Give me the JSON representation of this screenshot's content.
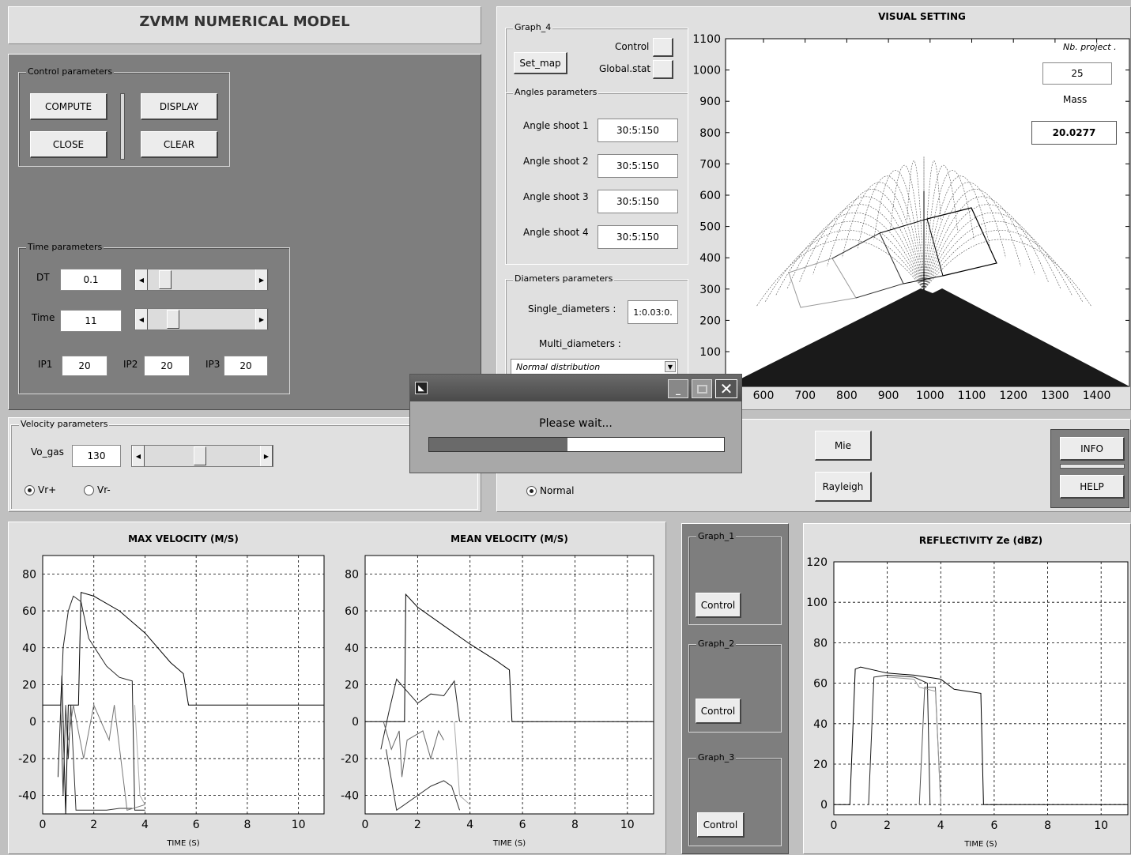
{
  "app": {
    "title": "ZVMM NUMERICAL MODEL"
  },
  "control": {
    "group": "Control parameters",
    "compute": "COMPUTE",
    "display": "DISPLAY",
    "close": "CLOSE",
    "clear": "CLEAR"
  },
  "time": {
    "group": "Time parameters",
    "dt_label": "DT",
    "dt_value": "0.1",
    "time_label": "Time",
    "time_value": "11",
    "ip1_label": "IP1",
    "ip1_value": "20",
    "ip2_label": "IP2",
    "ip2_value": "20",
    "ip3_label": "IP3",
    "ip3_value": "20",
    "dt_slider_fraction": 0.12,
    "time_slider_fraction": 0.2
  },
  "velocity": {
    "group": "Velocity parameters",
    "vo_label": "Vo_gas",
    "vo_value": "130",
    "vo_slider_fraction": 0.48,
    "vr_plus": "Vr+",
    "vr_minus": "Vr-",
    "vr_selected": "Vr+"
  },
  "graph4": {
    "group": "Graph_4",
    "set_map": "Set_map",
    "control_label": "Control",
    "global_label": "Global.stat"
  },
  "angles": {
    "group": "Angles parameters",
    "items": [
      {
        "label": "Angle shoot 1",
        "value": "30:5:150"
      },
      {
        "label": "Angle shoot 2",
        "value": "30:5:150"
      },
      {
        "label": "Angle shoot 3",
        "value": "30:5:150"
      },
      {
        "label": "Angle shoot 4",
        "value": "30:5:150"
      }
    ]
  },
  "diameters": {
    "group": "Diameters parameters",
    "single_label": "Single_diameters :",
    "single_value": "1:0.03:0.",
    "multi_label": "Multi_diameters :",
    "multi_value": "Normal distribution"
  },
  "visual": {
    "title": "VISUAL SETTING",
    "nb_project_label": "Nb. project .",
    "nb_project_value": "25",
    "mass_label": "Mass",
    "mass_value": "20.0277",
    "y_ticks": [
      "1100",
      "1000",
      "900",
      "800",
      "700",
      "600",
      "500",
      "400",
      "300",
      "200",
      "100"
    ],
    "x_ticks": [
      "600",
      "700",
      "800",
      "900",
      "1000",
      "1100",
      "1200",
      "1300",
      "1400"
    ]
  },
  "scatter": {
    "normal_label": "Normal",
    "mie": "Mie",
    "rayleigh": "Rayleigh",
    "info": "INFO",
    "help": "HELP"
  },
  "dialog": {
    "message": "Please wait...",
    "progress": 0.47,
    "minimize_icon": "minimize-icon",
    "maximize_icon": "maximize-icon",
    "close_icon": "close-icon"
  },
  "graphs": {
    "g1": "Graph_1",
    "g2": "Graph_2",
    "g3": "Graph_3",
    "control": "Control"
  },
  "chart_data": [
    {
      "type": "line",
      "title": "MAX VELOCITY (M/S)",
      "xlabel": "TIME (S)",
      "ylabel": "",
      "xlim": [
        0,
        11
      ],
      "ylim": [
        -50,
        90
      ],
      "x_ticks": [
        "0",
        "2",
        "4",
        "6",
        "8",
        "10"
      ],
      "y_ticks": [
        "80",
        "60",
        "40",
        "20",
        "0",
        "-20",
        "-40"
      ],
      "grid": true,
      "series": [
        {
          "stroke": "#000",
          "points": [
            [
              0,
              9
            ],
            [
              0.7,
              9
            ],
            [
              0.75,
              25
            ],
            [
              0.9,
              -50
            ],
            [
              1.0,
              9
            ],
            [
              1.4,
              9
            ],
            [
              1.5,
              70
            ],
            [
              2.0,
              68
            ],
            [
              3.0,
              60
            ],
            [
              4.0,
              48
            ],
            [
              5.0,
              32
            ],
            [
              5.5,
              26
            ],
            [
              5.7,
              9
            ],
            [
              11,
              9
            ]
          ]
        },
        {
          "stroke": "#222",
          "points": [
            [
              0.6,
              -30
            ],
            [
              0.8,
              40
            ],
            [
              1.0,
              60
            ],
            [
              1.2,
              68
            ],
            [
              1.5,
              65
            ],
            [
              1.8,
              45
            ],
            [
              2.5,
              30
            ],
            [
              3.0,
              24
            ],
            [
              3.5,
              22
            ],
            [
              3.6,
              -48
            ],
            [
              4.0,
              -48
            ]
          ]
        },
        {
          "stroke": "#333",
          "points": [
            [
              0.7,
              9
            ],
            [
              0.8,
              -40
            ],
            [
              0.9,
              9
            ],
            [
              1.0,
              -20
            ],
            [
              1.1,
              9
            ],
            [
              1.3,
              -48
            ],
            [
              1.5,
              -48
            ],
            [
              2.5,
              -48
            ],
            [
              3.0,
              -47
            ],
            [
              3.5,
              -47
            ]
          ]
        },
        {
          "stroke": "#777",
          "points": [
            [
              1.0,
              -10
            ],
            [
              1.2,
              9
            ],
            [
              1.6,
              -20
            ],
            [
              2.0,
              9
            ],
            [
              2.6,
              -10
            ],
            [
              2.8,
              9
            ],
            [
              3.3,
              -48
            ],
            [
              4.0,
              -45
            ]
          ]
        },
        {
          "stroke": "#aaa",
          "points": [
            [
              3.6,
              9
            ],
            [
              3.8,
              -40
            ],
            [
              4.0,
              -45
            ]
          ]
        }
      ]
    },
    {
      "type": "line",
      "title": "MEAN VELOCITY (M/S)",
      "xlabel": "TIME (S)",
      "ylabel": "",
      "xlim": [
        0,
        11
      ],
      "ylim": [
        -50,
        90
      ],
      "x_ticks": [
        "0",
        "2",
        "4",
        "6",
        "8",
        "10"
      ],
      "y_ticks": [
        "80",
        "60",
        "40",
        "20",
        "0",
        "-20",
        "-40"
      ],
      "grid": true,
      "series": [
        {
          "stroke": "#000",
          "points": [
            [
              0,
              0
            ],
            [
              1.5,
              0
            ],
            [
              1.55,
              69
            ],
            [
              2.0,
              62
            ],
            [
              3.0,
              52
            ],
            [
              4.0,
              42
            ],
            [
              5.0,
              33
            ],
            [
              5.5,
              28
            ],
            [
              5.6,
              0
            ],
            [
              11,
              0
            ]
          ]
        },
        {
          "stroke": "#222",
          "points": [
            [
              0.6,
              -15
            ],
            [
              0.9,
              5
            ],
            [
              1.2,
              23
            ],
            [
              1.5,
              18
            ],
            [
              2.0,
              10
            ],
            [
              2.5,
              15
            ],
            [
              3.0,
              14
            ],
            [
              3.4,
              22
            ],
            [
              3.6,
              0
            ]
          ]
        },
        {
          "stroke": "#333",
          "points": [
            [
              0.8,
              -15
            ],
            [
              1.2,
              -48
            ],
            [
              1.5,
              -45
            ],
            [
              2.5,
              -35
            ],
            [
              3.0,
              -32
            ],
            [
              3.3,
              -35
            ],
            [
              3.6,
              -48
            ]
          ]
        },
        {
          "stroke": "#666",
          "points": [
            [
              0.7,
              0
            ],
            [
              1.0,
              -15
            ],
            [
              1.3,
              -5
            ],
            [
              1.4,
              -30
            ],
            [
              1.6,
              -10
            ],
            [
              2.2,
              -5
            ],
            [
              2.5,
              -20
            ],
            [
              2.8,
              -5
            ],
            [
              3.0,
              -10
            ]
          ]
        },
        {
          "stroke": "#aaa",
          "points": [
            [
              3.4,
              0
            ],
            [
              3.6,
              -40
            ],
            [
              4.0,
              -45
            ]
          ]
        }
      ]
    },
    {
      "type": "line",
      "title": "REFLECTIVITY Ze (dBZ)",
      "xlabel": "TIME (S)",
      "ylabel": "",
      "xlim": [
        0,
        11
      ],
      "ylim": [
        -5,
        120
      ],
      "x_ticks": [
        "0",
        "2",
        "4",
        "6",
        "8",
        "10"
      ],
      "y_ticks": [
        "120",
        "100",
        "80",
        "60",
        "40",
        "20",
        "0"
      ],
      "grid": true,
      "series": [
        {
          "stroke": "#000",
          "points": [
            [
              0,
              0
            ],
            [
              0.6,
              0
            ],
            [
              0.8,
              67
            ],
            [
              1.0,
              68
            ],
            [
              2.0,
              65
            ],
            [
              3.0,
              64
            ],
            [
              4.0,
              62
            ],
            [
              4.5,
              57
            ],
            [
              5.5,
              55
            ],
            [
              5.6,
              0
            ],
            [
              11,
              0
            ]
          ]
        },
        {
          "stroke": "#222",
          "points": [
            [
              1.3,
              0
            ],
            [
              1.5,
              63
            ],
            [
              2.0,
              64
            ],
            [
              3.0,
              63
            ],
            [
              3.5,
              60
            ],
            [
              3.6,
              0
            ]
          ]
        },
        {
          "stroke": "#555",
          "points": [
            [
              3.2,
              0
            ],
            [
              3.4,
              58
            ],
            [
              3.8,
              58
            ],
            [
              4.0,
              0
            ]
          ]
        },
        {
          "stroke": "#999",
          "points": [
            [
              2.0,
              63
            ],
            [
              3.0,
              62
            ],
            [
              3.2,
              58
            ],
            [
              3.8,
              56
            ],
            [
              4.0,
              0
            ]
          ]
        }
      ]
    }
  ]
}
